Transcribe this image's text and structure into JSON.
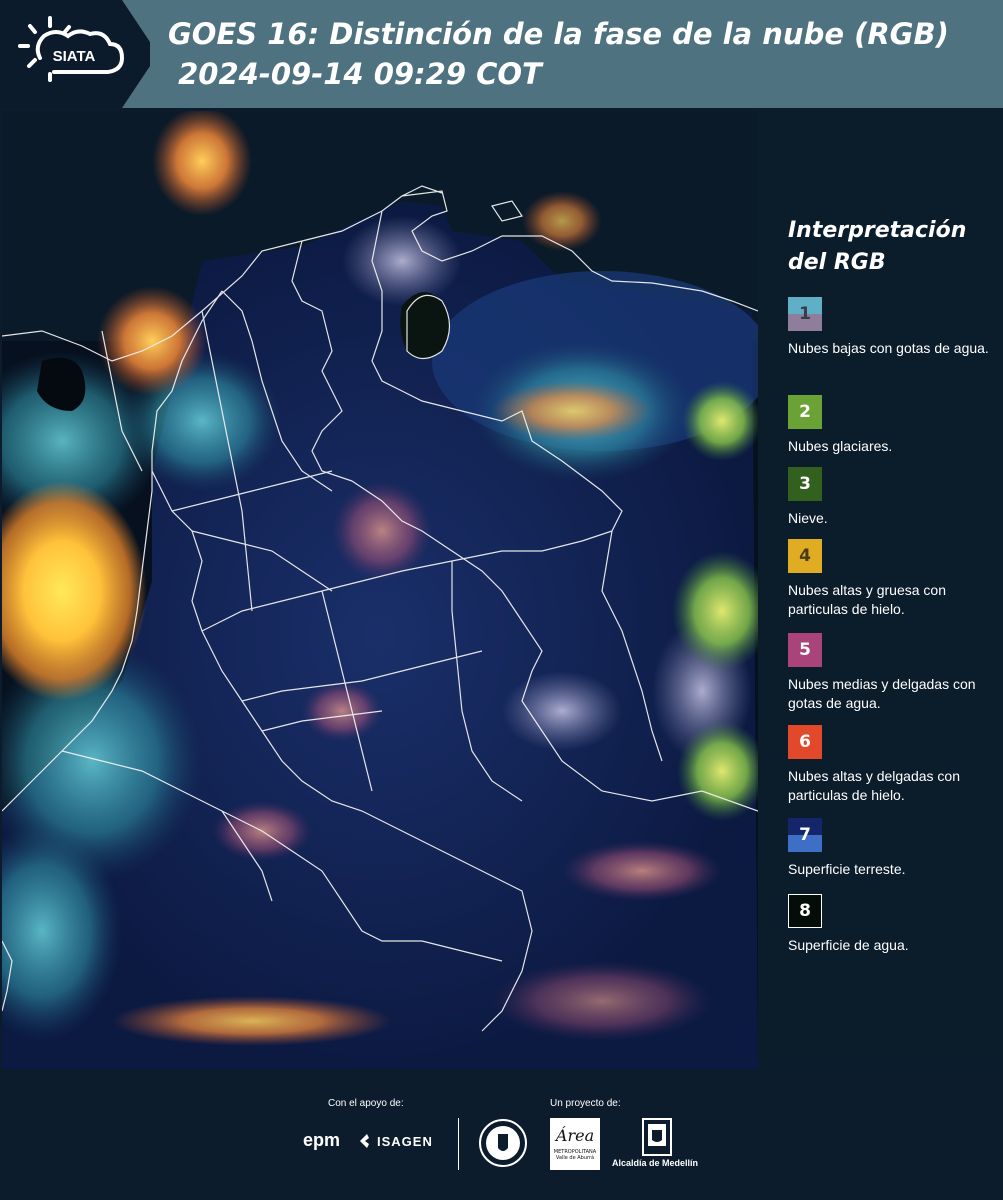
{
  "header": {
    "logo_text": "SIATA",
    "title_line1": "GOES 16: Distinción de la fase de la nube (RGB)",
    "title_line2": " 2024-09-14 09:29 COT"
  },
  "legend": {
    "title": "Interpretación del RGB",
    "items": [
      {
        "number": "1",
        "label": "Nubes bajas con gotas de agua.",
        "color_top": "#5fb0c6",
        "color_bottom": "#8e7e9c"
      },
      {
        "number": "2",
        "label": "Nubes glaciares.",
        "color": "#6aa235"
      },
      {
        "number": "3",
        "label": "Nieve.",
        "color": "#31601f"
      },
      {
        "number": "4",
        "label": "Nubes altas y gruesa con particulas de hielo.",
        "color": "#e0ad22"
      },
      {
        "number": "5",
        "label": "Nubes medias y delgadas con gotas de agua.",
        "color": "#a8447a"
      },
      {
        "number": "6",
        "label": "Nubes altas y delgadas con particulas de hielo.",
        "color": "#e1492a"
      },
      {
        "number": "7",
        "label": "Superficie terreste.",
        "color_top": "#14256a",
        "color_bottom": "#3f6ec6"
      },
      {
        "number": "8",
        "label": "Superficie de agua.",
        "color": "#050d08"
      }
    ]
  },
  "footer": {
    "support_label": "Con el apoyo de:",
    "project_label": "Un proyecto de:",
    "sponsors": [
      "epm",
      "ISAGEN"
    ],
    "partner_area_text": "Área",
    "partner_area_sub": "METROPOLITANA",
    "partner_area_sub2": "Valle de Aburrá",
    "partner_alcaldia": "Alcaldía de Medellín"
  }
}
